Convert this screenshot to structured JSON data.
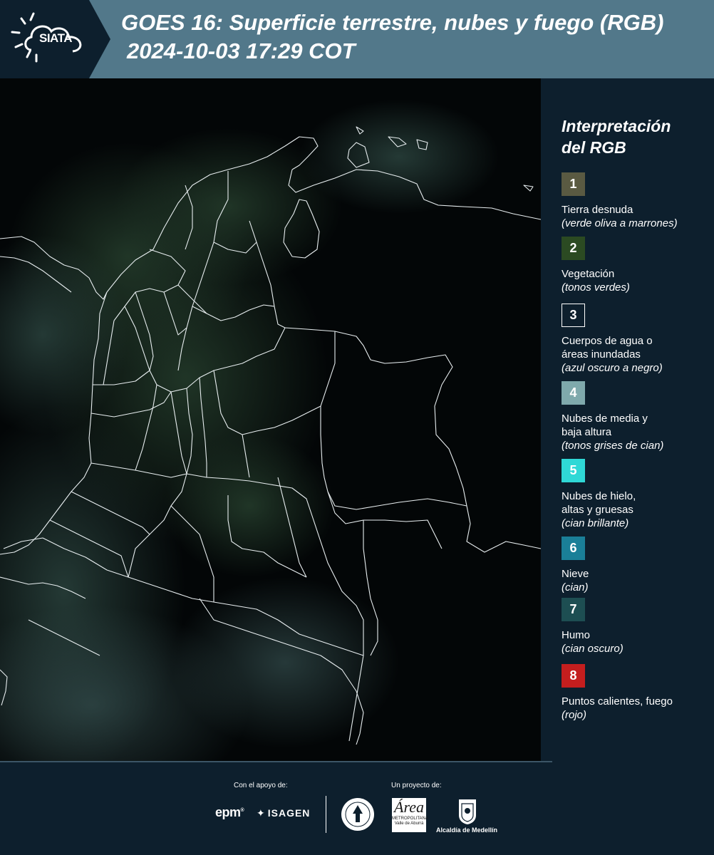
{
  "header": {
    "logo_text": "SIATA",
    "title_line1": "GOES 16: Superficie terrestre, nubes y fuego (RGB)",
    "title_line2": "2024-10-03 17:29 COT"
  },
  "legend": {
    "title_line1": "Interpretación",
    "title_line2": "del RGB",
    "items": [
      {
        "number": "1",
        "color": "#5a5a42",
        "label_lines": [
          "Tierra desnuda"
        ],
        "sub": "(verde oliva a marrones)"
      },
      {
        "number": "2",
        "color": "#2b4a22",
        "label_lines": [
          "Vegetación"
        ],
        "sub": "(tonos verdes)"
      },
      {
        "number": "3",
        "color": "#0d1f2d",
        "label_lines": [
          "Cuerpos de agua o",
          "áreas inundadas"
        ],
        "sub": "(azul oscuro a negro)"
      },
      {
        "number": "4",
        "color": "#7fa9ac",
        "label_lines": [
          "Nubes de media y",
          "baja altura"
        ],
        "sub": "(tonos grises de cian)"
      },
      {
        "number": "5",
        "color": "#2fd8d6",
        "label_lines": [
          "Nubes de hielo,",
          "altas y gruesas"
        ],
        "sub": "(cian brillante)"
      },
      {
        "number": "6",
        "color": "#1a7f98",
        "label_lines": [
          "Nieve"
        ],
        "sub": "(cian)"
      },
      {
        "number": "7",
        "color": "#1d4e52",
        "label_lines": [
          "Humo"
        ],
        "sub": "(cian oscuro)"
      },
      {
        "number": "8",
        "color": "#c41e1e",
        "label_lines": [
          "Puntos calientes, fuego"
        ],
        "sub": "(rojo)"
      }
    ]
  },
  "footer": {
    "support_label": "Con el apoyo de:",
    "project_label": "Un proyecto de:",
    "epm": "epm",
    "isagen": "ISAGEN",
    "area_big": "Área",
    "area_small": "METROPOLITANA",
    "area_small2": "Valle de Aburrá",
    "alcaldia": "Alcaldía de Medellín"
  }
}
